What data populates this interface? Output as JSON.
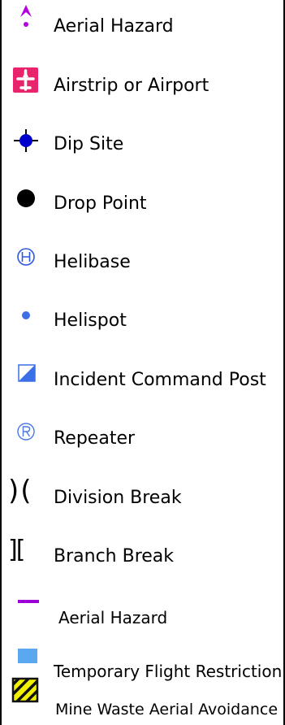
{
  "legend": {
    "items": [
      {
        "icon": "aerial-hazard-point-icon",
        "label": "Aerial Hazard",
        "color": "#b400e0"
      },
      {
        "icon": "airstrip-icon",
        "label": "Airstrip or Airport",
        "color": "#e8256c"
      },
      {
        "icon": "dip-site-icon",
        "label": "Dip Site",
        "color": "#0000cc"
      },
      {
        "icon": "drop-point-icon",
        "label": "Drop Point",
        "color": "#000000"
      },
      {
        "icon": "helibase-icon",
        "label": "Helibase",
        "color": "#2f56e0"
      },
      {
        "icon": "helispot-icon",
        "label": "Helispot",
        "color": "#3f6fe8"
      },
      {
        "icon": "icp-icon",
        "label": "Incident Command Post",
        "color": "#3a6fe8"
      },
      {
        "icon": "repeater-icon",
        "label": "Repeater",
        "color": "#4a78e6"
      },
      {
        "icon": "division-break-icon",
        "label": "Division Break",
        "glyph": ")(",
        "color": "#000000"
      },
      {
        "icon": "branch-break-icon",
        "label": "Branch Break",
        "glyph": "][",
        "color": "#000000"
      },
      {
        "icon": "aerial-hazard-line-icon",
        "label": "Aerial Hazard",
        "color": "#9b00d8"
      },
      {
        "icon": "tfr-icon",
        "label": "Temporary Flight Restriction",
        "color": "#5aa9f0"
      },
      {
        "icon": "mine-waste-icon",
        "label": "Mine Waste Aerial Avoidance",
        "color": "#f2f200"
      }
    ]
  }
}
